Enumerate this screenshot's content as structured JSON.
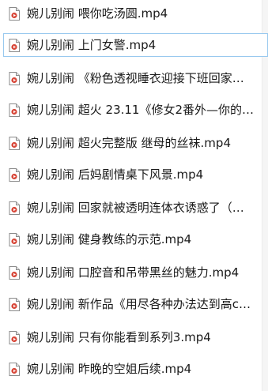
{
  "files": [
    {
      "name": "婉儿别闹 喂你吃汤圆.mp4",
      "selected": false
    },
    {
      "name": "婉儿别闹 上门女警.mp4",
      "selected": true
    },
    {
      "name": "婉儿别闹 《粉色透视睡衣迎接下班回家…",
      "selected": false
    },
    {
      "name": "婉儿别闹 超火 23.11《修女2番外—你的…",
      "selected": false
    },
    {
      "name": "婉儿别闹 超火完整版 继母的丝袜.mp4",
      "selected": false
    },
    {
      "name": "婉儿别闹 后妈剧情桌下风景.mp4",
      "selected": false
    },
    {
      "name": "婉儿别闹 回家就被透明连体衣诱惑了（…",
      "selected": false
    },
    {
      "name": "婉儿别闹 健身教练的示范.mp4",
      "selected": false
    },
    {
      "name": "婉儿别闹 口腔音和吊带黑丝的魅力.mp4",
      "selected": false
    },
    {
      "name": "婉儿别闹 新作品《用尽各种办法达到高c…",
      "selected": false
    },
    {
      "name": "婉儿别闹 只有你能看到系列3.mp4",
      "selected": false
    },
    {
      "name": "婉儿别闹 昨晚的空姐后续.mp4",
      "selected": false
    }
  ],
  "icon": "video-file-icon"
}
